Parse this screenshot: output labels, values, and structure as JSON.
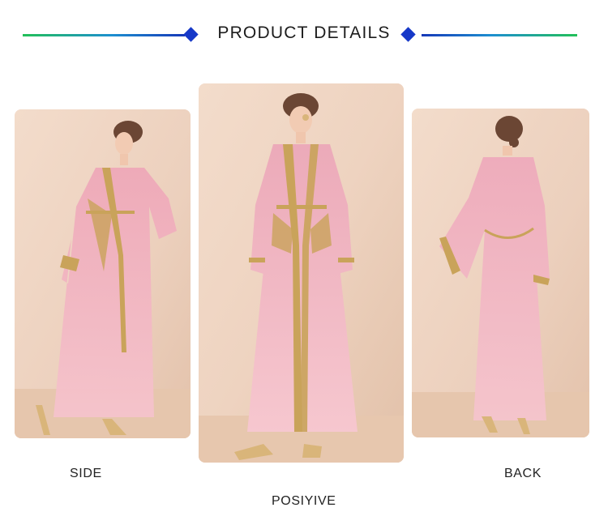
{
  "header": {
    "title": "PRODUCT DETAILS"
  },
  "views": {
    "side": {
      "caption": "SIDE"
    },
    "front": {
      "caption": "POSIYIVE"
    },
    "back": {
      "caption": "BACK"
    }
  },
  "colors": {
    "gradient_green": "#22c058",
    "gradient_blue": "#1638b8",
    "diamond": "#1638c8",
    "wall": "#efd4c2",
    "dress_pink": "#f2b6c2",
    "trim_gold": "#c9a35a"
  }
}
